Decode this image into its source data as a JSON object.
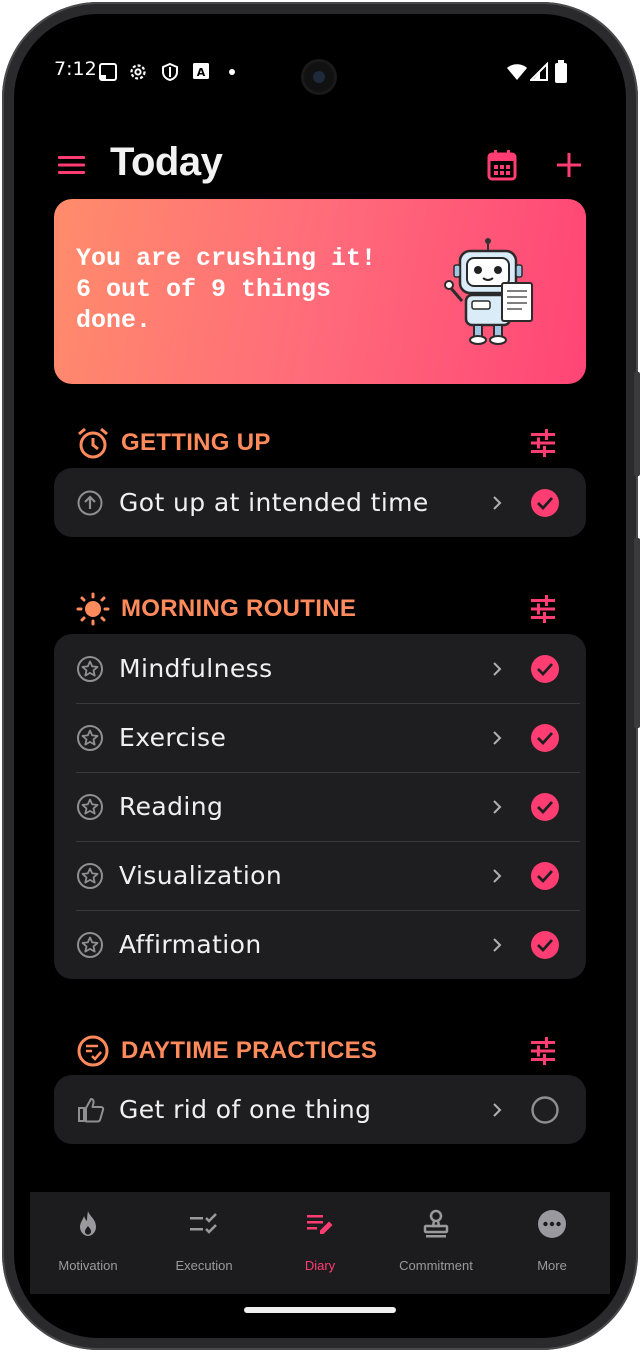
{
  "status_bar": {
    "time": "7:12"
  },
  "header": {
    "title": "Today"
  },
  "banner": {
    "message": "You are crushing it!\n6 out of 9 things\ndone."
  },
  "sections": [
    {
      "title": "GETTING UP",
      "items": [
        {
          "label": "Got up at intended time",
          "done": true
        }
      ]
    },
    {
      "title": "MORNING ROUTINE",
      "items": [
        {
          "label": "Mindfulness",
          "done": true
        },
        {
          "label": "Exercise",
          "done": true
        },
        {
          "label": "Reading",
          "done": true
        },
        {
          "label": "Visualization",
          "done": true
        },
        {
          "label": "Affirmation",
          "done": true
        }
      ]
    },
    {
      "title": "DAYTIME PRACTICES",
      "items": [
        {
          "label": "Get rid of one thing",
          "done": false
        }
      ]
    }
  ],
  "bottom_nav": {
    "items": [
      {
        "label": "Motivation",
        "icon": "flame-icon"
      },
      {
        "label": "Execution",
        "icon": "checklist-icon"
      },
      {
        "label": "Diary",
        "icon": "edit-notes-icon",
        "active": true
      },
      {
        "label": "Commitment",
        "icon": "stamp-icon"
      },
      {
        "label": "More",
        "icon": "more-horizontal-icon"
      }
    ]
  },
  "colors": {
    "accent": "#ff3d72",
    "section_title": "#ff8a5c",
    "card_bg": "#1e1e20",
    "background": "#000000"
  }
}
